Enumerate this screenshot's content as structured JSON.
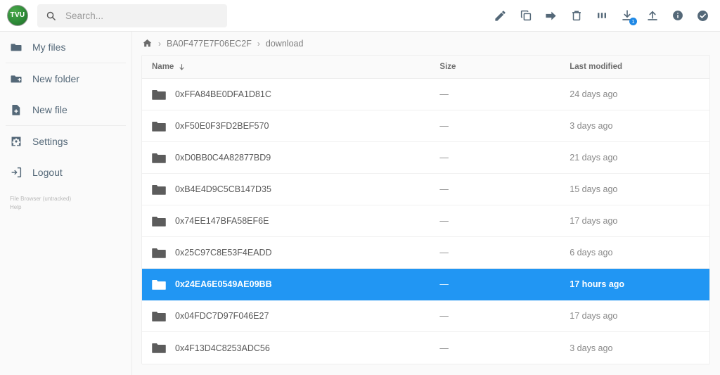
{
  "header": {
    "logo_text": "TVU",
    "logo_icon": "tvu-circle-logo",
    "search": {
      "icon": "search-icon",
      "placeholder": "Search...",
      "value": ""
    },
    "actions": [
      {
        "name": "rename-button",
        "icon": "pencil-icon",
        "label": "Rename"
      },
      {
        "name": "copy-button",
        "icon": "copy-icon",
        "label": "Copy"
      },
      {
        "name": "move-button",
        "icon": "arrow-right-icon",
        "label": "Move"
      },
      {
        "name": "delete-button",
        "icon": "trash-icon",
        "label": "Delete"
      },
      {
        "name": "view-button",
        "icon": "columns-icon",
        "label": "Switch view"
      },
      {
        "name": "download-button",
        "icon": "download-icon",
        "label": "Download",
        "badge": "1"
      },
      {
        "name": "upload-button",
        "icon": "upload-icon",
        "label": "Upload"
      },
      {
        "name": "info-button",
        "icon": "info-circle-icon",
        "label": "File information"
      },
      {
        "name": "select-button",
        "icon": "check-circle-icon",
        "label": "Select multiple"
      }
    ]
  },
  "sidebar": {
    "items": [
      {
        "label": "My files",
        "icon": "folder-icon"
      },
      {
        "label": "New folder",
        "icon": "folder-plus-icon"
      },
      {
        "label": "New file",
        "icon": "file-plus-icon"
      },
      {
        "label": "Settings",
        "icon": "gear-icon"
      },
      {
        "label": "Logout",
        "icon": "logout-icon"
      }
    ],
    "footer": {
      "app": "File Browser (untracked)",
      "help": "Help"
    }
  },
  "breadcrumb": {
    "home_icon": "home-icon",
    "separator": "›",
    "items": [
      "BA0F477E7F06EC2F",
      "download"
    ]
  },
  "file_list": {
    "columns": {
      "name": "Name",
      "sort_icon": "arrow-down-icon",
      "size": "Size",
      "modified": "Last modified"
    },
    "rows": [
      {
        "name": "0xFFA84BE0DFA1D81C",
        "size": "—",
        "modified": "24 days ago",
        "icon": "folder-icon",
        "selected": false
      },
      {
        "name": "0xF50E0F3FD2BEF570",
        "size": "—",
        "modified": "3 days ago",
        "icon": "folder-icon",
        "selected": false
      },
      {
        "name": "0xD0BB0C4A82877BD9",
        "size": "—",
        "modified": "21 days ago",
        "icon": "folder-icon",
        "selected": false
      },
      {
        "name": "0xB4E4D9C5CB147D35",
        "size": "—",
        "modified": "15 days ago",
        "icon": "folder-icon",
        "selected": false
      },
      {
        "name": "0x74EE147BFA58EF6E",
        "size": "—",
        "modified": "17 days ago",
        "icon": "folder-icon",
        "selected": false
      },
      {
        "name": "0x25C97C8E53F4EADD",
        "size": "—",
        "modified": "6 days ago",
        "icon": "folder-icon",
        "selected": false
      },
      {
        "name": "0x24EA6E0549AE09BB",
        "size": "—",
        "modified": "17 hours ago",
        "icon": "folder-icon",
        "selected": true
      },
      {
        "name": "0x04FDC7D97F046E27",
        "size": "—",
        "modified": "17 days ago",
        "icon": "folder-icon",
        "selected": false
      },
      {
        "name": "0x4F13D4C8253ADC56",
        "size": "—",
        "modified": "3 days ago",
        "icon": "folder-icon",
        "selected": false
      }
    ]
  },
  "colors": {
    "selection_blue": "#2196f3",
    "badge_blue": "#1e88e5",
    "icon_slate": "#546878",
    "logo_green": "#2e8b38"
  }
}
